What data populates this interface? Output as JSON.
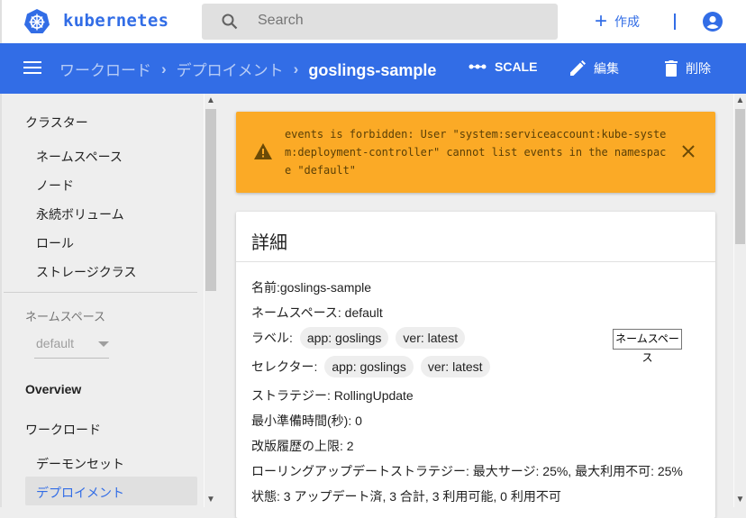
{
  "topbar": {
    "brand": "kubernetes",
    "search_placeholder": "Search",
    "create_label": "作成"
  },
  "appbar": {
    "breadcrumbs": [
      "ワークロード",
      "デプロイメント"
    ],
    "current": "goslings-sample",
    "scale_label": "SCALE",
    "edit_label": "編集",
    "delete_label": "削除"
  },
  "sidebar": {
    "cluster_header": "クラスター",
    "cluster_items": [
      "ネームスペース",
      "ノード",
      "永続ボリューム",
      "ロール",
      "ストレージクラス"
    ],
    "namespace_label": "ネームスペース",
    "namespace_value": "default",
    "overview": "Overview",
    "workload_header": "ワークロード",
    "workload_items": [
      "デーモンセット",
      "デプロイメント"
    ]
  },
  "alert": {
    "message": "events is forbidden: User \"system:serviceaccount:kube-system:deployment-controller\" cannot list events in the namespace \"default\""
  },
  "details": {
    "title": "詳細",
    "name_label": "名前: ",
    "name_value": "goslings-sample",
    "namespace_row": "ネームスペース: default",
    "labels_label": "ラベル:",
    "labels": [
      "app: goslings",
      "ver: latest"
    ],
    "selector_label": "セレクター:",
    "selectors": [
      "app: goslings",
      "ver: latest"
    ],
    "strategy": "ストラテジー: RollingUpdate",
    "min_ready": "最小準備時間(秒): 0",
    "revision_limit": "改版履歴の上限: 2",
    "rolling_update": "ローリングアップデートストラテジー: 最大サージ: 25%, 最大利用不可: 25%",
    "status": "状態: 3 アップデート済, 3 合計, 3 利用可能, 0 利用不可"
  },
  "tooltip": {
    "text": "ネームスペース"
  },
  "colors": {
    "primary": "#326de6",
    "warning": "#fbaa26"
  }
}
